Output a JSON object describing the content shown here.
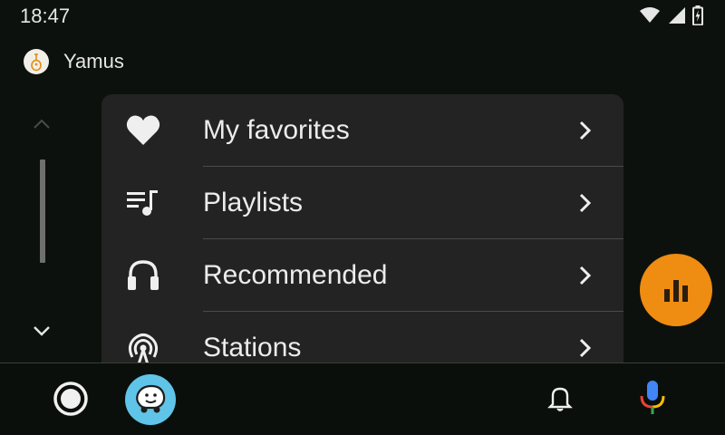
{
  "status_bar": {
    "time": "18:47",
    "icons": [
      "wifi-icon",
      "cell-signal-icon",
      "battery-charging-icon"
    ]
  },
  "app": {
    "name": "Yamus",
    "logo_icon": "yamus-logo-icon"
  },
  "sidebar": {
    "scroll_up_icon": "chevron-up-icon",
    "scroll_down_icon": "chevron-down-icon"
  },
  "menu": {
    "items": [
      {
        "label": "My favorites",
        "icon": "heart-icon"
      },
      {
        "label": "Playlists",
        "icon": "playlist-icon"
      },
      {
        "label": "Recommended",
        "icon": "headphones-icon"
      },
      {
        "label": "Stations",
        "icon": "radio-tower-icon"
      }
    ]
  },
  "fab": {
    "icon": "equalizer-icon",
    "color": "#ef8c12"
  },
  "bottom_bar": {
    "home_icon": "home-circle-icon",
    "waze_icon": "waze-icon",
    "notification_icon": "bell-icon",
    "mic_icon": "google-mic-icon"
  },
  "colors": {
    "background": "#0d110e",
    "card": "#232323",
    "accent": "#ef8c12",
    "waze": "#5fc4e8"
  }
}
